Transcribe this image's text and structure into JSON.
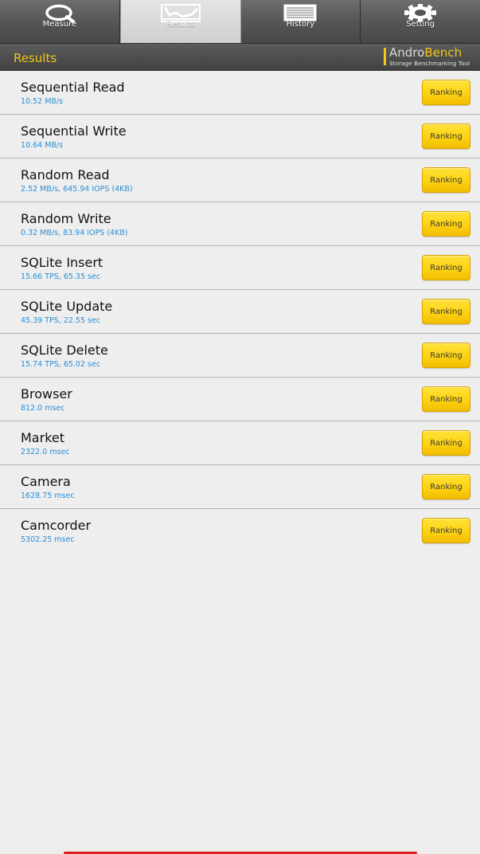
{
  "tabs": [
    {
      "label": "Measure",
      "icon": "magnifier-icon",
      "active": false
    },
    {
      "label": "Results",
      "icon": "chart-icon",
      "active": true
    },
    {
      "label": "History",
      "icon": "list-icon",
      "active": false
    },
    {
      "label": "Setting",
      "icon": "gear-icon",
      "active": false
    }
  ],
  "header": {
    "title": "Results",
    "logo": {
      "andro": "Andro",
      "bench": "Bench",
      "tagline": "Storage Benchmarking Tool"
    }
  },
  "results": [
    {
      "name": "Sequential Read",
      "value": "10.52 MB/s",
      "button": "Ranking"
    },
    {
      "name": "Sequential Write",
      "value": "10.64 MB/s",
      "button": "Ranking"
    },
    {
      "name": "Random Read",
      "value": "2.52 MB/s, 645.94 IOPS (4KB)",
      "button": "Ranking"
    },
    {
      "name": "Random Write",
      "value": "0.32 MB/s, 83.94 IOPS (4KB)",
      "button": "Ranking"
    },
    {
      "name": "SQLite Insert",
      "value": "15.66 TPS, 65.35 sec",
      "button": "Ranking"
    },
    {
      "name": "SQLite Update",
      "value": "45.39 TPS, 22.55 sec",
      "button": "Ranking"
    },
    {
      "name": "SQLite Delete",
      "value": "15.74 TPS, 65.02 sec",
      "button": "Ranking"
    },
    {
      "name": "Browser",
      "value": "812.0 msec",
      "button": "Ranking"
    },
    {
      "name": "Market",
      "value": "2322.0 msec",
      "button": "Ranking"
    },
    {
      "name": "Camera",
      "value": "1628.75 msec",
      "button": "Ranking"
    },
    {
      "name": "Camcorder",
      "value": "5302.25 msec",
      "button": "Ranking"
    }
  ],
  "colors": {
    "accent": "#f5c518",
    "value_text": "#2a8fd6",
    "button": "#fcd212",
    "bottom_line": "#e02020"
  }
}
